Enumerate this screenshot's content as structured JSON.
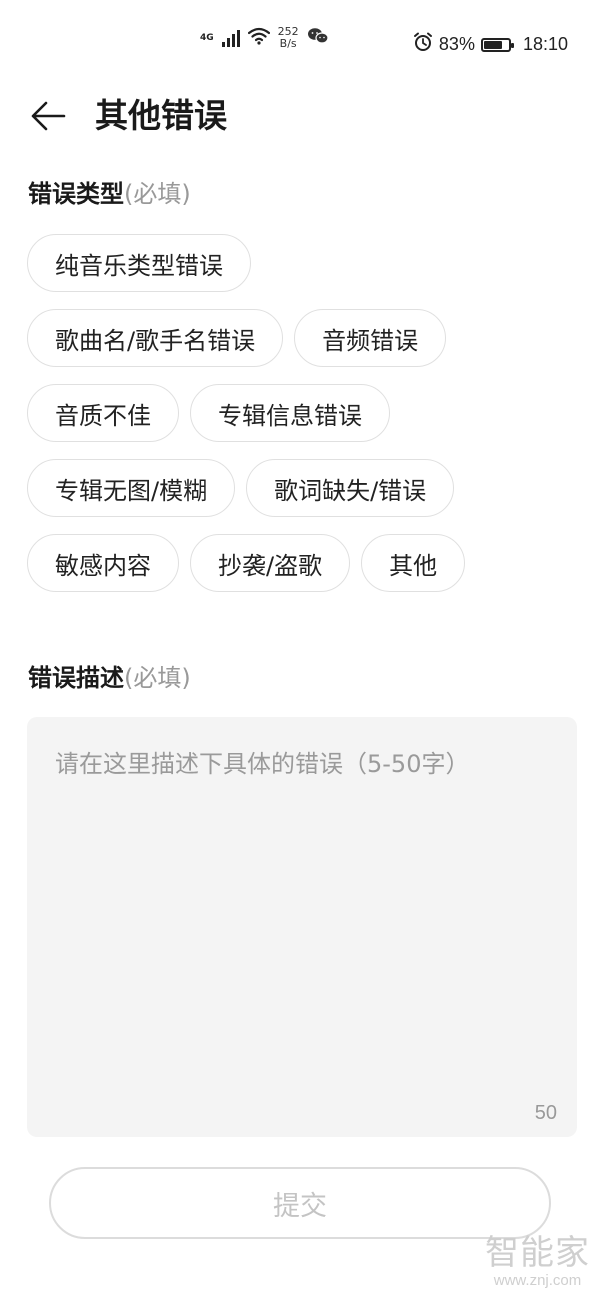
{
  "status_bar": {
    "network": "4G",
    "speed_value": "252",
    "speed_unit": "B/s",
    "battery": "83%",
    "battery_level": 0.83,
    "time": "18:10"
  },
  "header": {
    "title": "其他错误"
  },
  "error_type": {
    "label": "错误类型",
    "required_hint": "(必填)",
    "options": [
      [
        "纯音乐类型错误"
      ],
      [
        "歌曲名/歌手名错误",
        "音频错误"
      ],
      [
        "音质不佳",
        "专辑信息错误"
      ],
      [
        "专辑无图/模糊",
        "歌词缺失/错误"
      ],
      [
        "敏感内容",
        "抄袭/盗歌",
        "其他"
      ]
    ]
  },
  "error_desc": {
    "label": "错误描述",
    "required_hint": "(必填)",
    "value": "",
    "placeholder": "请在这里描述下具体的错误（5-50字）",
    "counter": "50"
  },
  "submit_label": "提交",
  "watermark": {
    "main": "智能家",
    "sub": "www.znj.com"
  }
}
